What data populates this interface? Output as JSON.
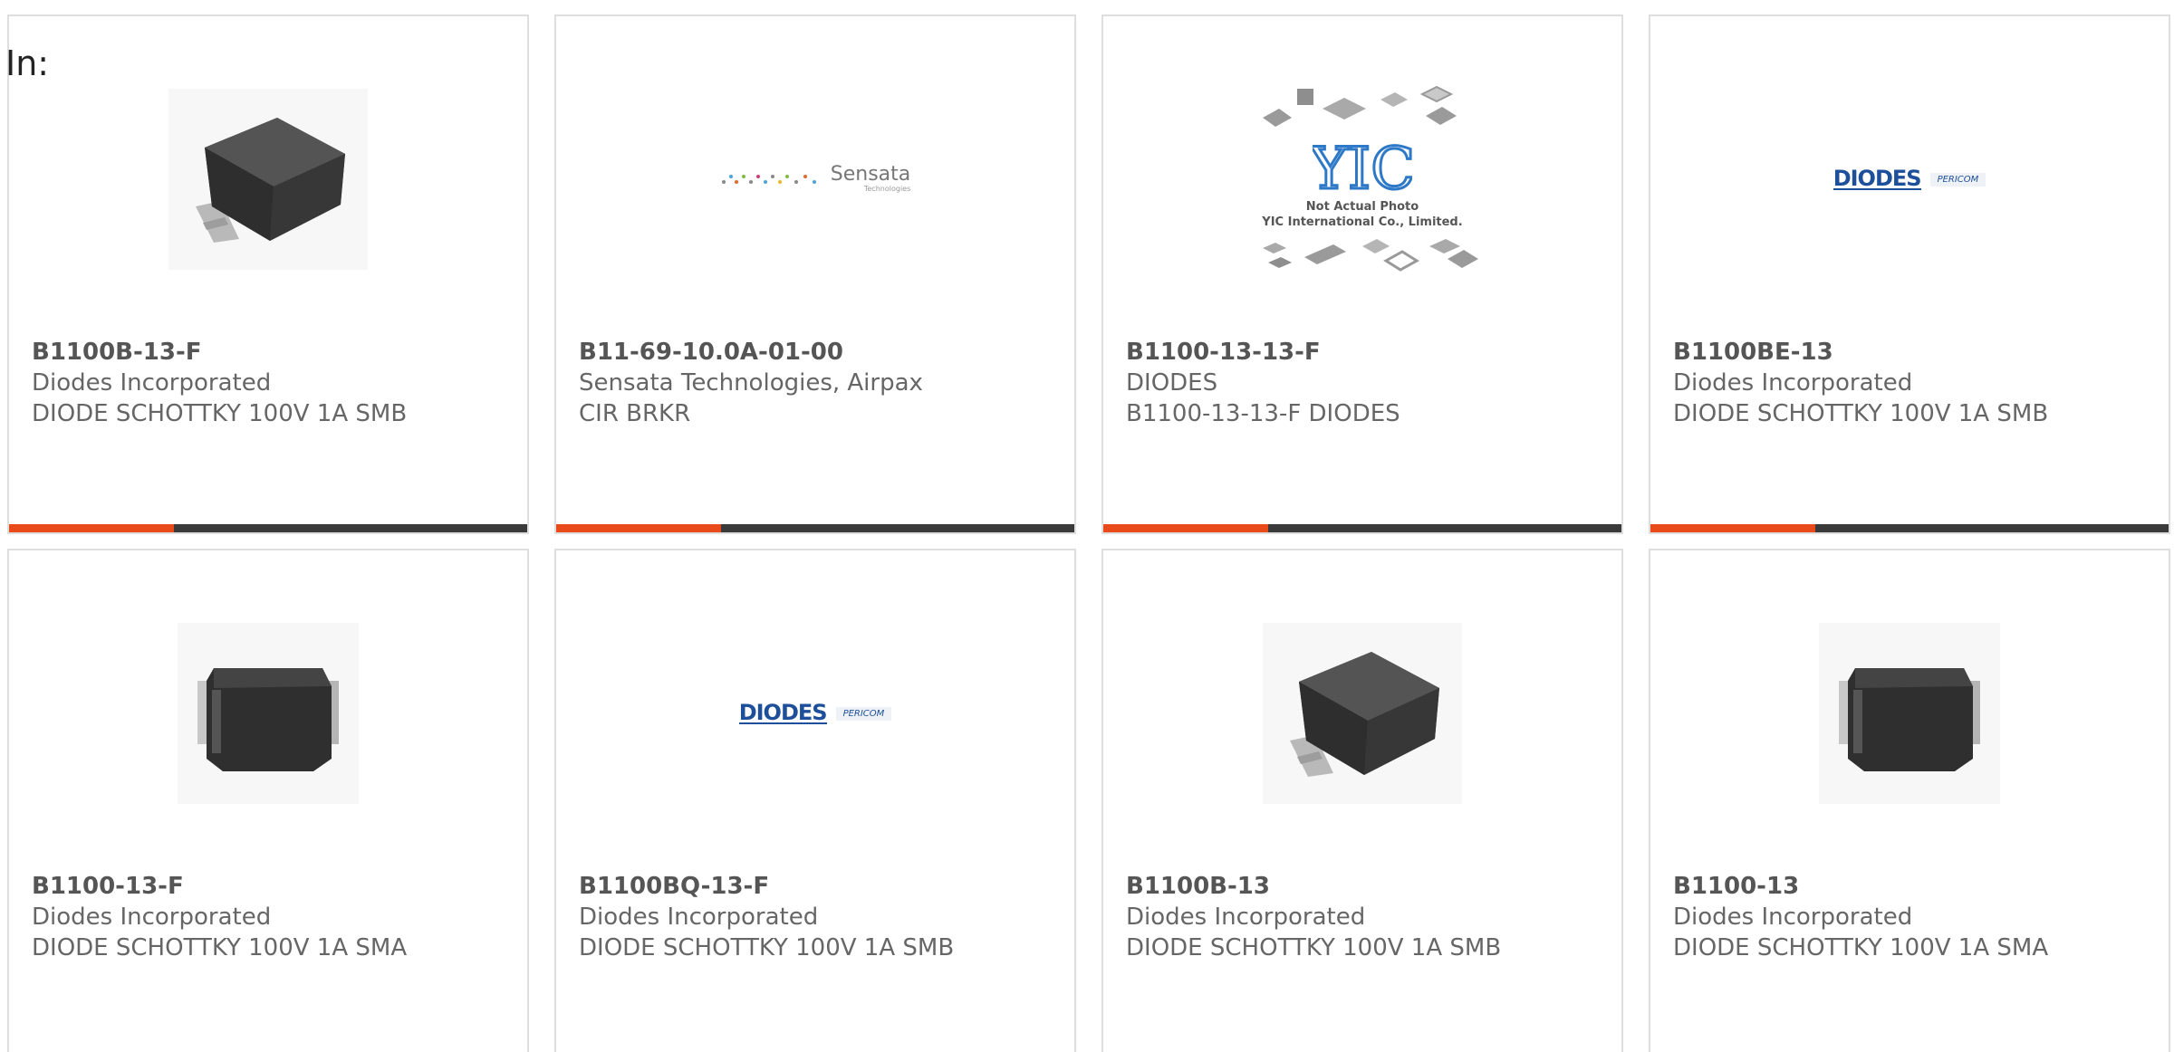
{
  "header": {
    "in_label": "In:"
  },
  "colors": {
    "accent": "#e84a1a",
    "bar": "#3a3a3a"
  },
  "cards": [
    {
      "part": "B1100B-13-F",
      "manufacturer": "Diodes Incorporated",
      "description": "DIODE SCHOTTKY 100V 1A SMB",
      "image": "smb-package-photo"
    },
    {
      "part": "B11-69-10.0A-01-00",
      "manufacturer": "Sensata Technologies, Airpax",
      "description": "CIR BRKR",
      "image": "sensata-logo",
      "logo_text": "Sensata",
      "logo_subtext": "Technologies"
    },
    {
      "part": "B1100-13-13-F",
      "manufacturer": "DIODES",
      "description": "B1100-13-13-F DIODES",
      "image": "yic-placeholder",
      "placeholder_line1": "Not Actual Photo",
      "placeholder_line2": "YIC International Co., Limited."
    },
    {
      "part": "B1100BE-13",
      "manufacturer": "Diodes Incorporated",
      "description": "DIODE SCHOTTKY 100V 1A SMB",
      "image": "diodes-pericom-logo",
      "logo_text": "DIODES",
      "logo_subtext": "PERICOM"
    },
    {
      "part": "B1100-13-F",
      "manufacturer": "Diodes Incorporated",
      "description": "DIODE SCHOTTKY 100V 1A SMA",
      "image": "sma-package-photo"
    },
    {
      "part": "B1100BQ-13-F",
      "manufacturer": "Diodes Incorporated",
      "description": "DIODE SCHOTTKY 100V 1A SMB",
      "image": "diodes-pericom-logo",
      "logo_text": "DIODES",
      "logo_subtext": "PERICOM"
    },
    {
      "part": "B1100B-13",
      "manufacturer": "Diodes Incorporated",
      "description": "DIODE SCHOTTKY 100V 1A SMB",
      "image": "smb-package-photo"
    },
    {
      "part": "B1100-13",
      "manufacturer": "Diodes Incorporated",
      "description": "DIODE SCHOTTKY 100V 1A SMA",
      "image": "sma-package-photo"
    }
  ]
}
